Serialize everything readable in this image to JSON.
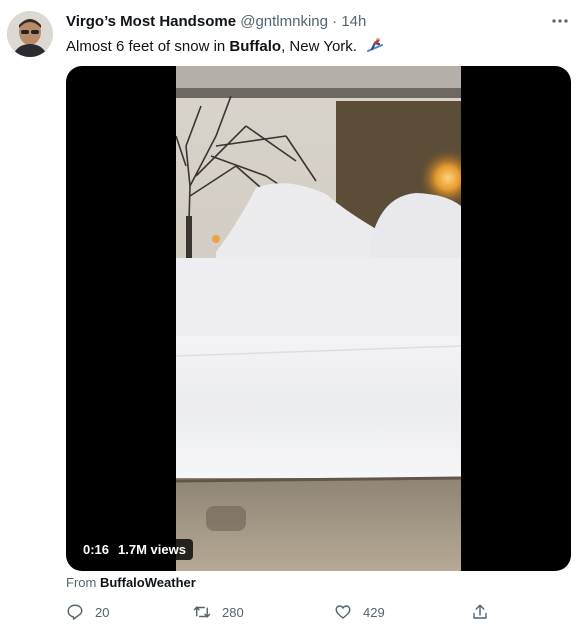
{
  "tweet": {
    "author_name": "Virgo’s Most Handsome",
    "handle": "@gntlmnking",
    "separator": "·",
    "time": "14h",
    "text_before": "Almost 6 feet of snow in ",
    "text_bold": "Buffalo",
    "text_after": ", New York."
  },
  "media": {
    "duration": "0:16",
    "views": "1.7M views"
  },
  "attribution": {
    "prefix": "From",
    "source": "BuffaloWeather"
  },
  "actions": {
    "replies": "20",
    "retweets": "280",
    "likes": "429"
  },
  "icons": {
    "more": "more-horizontal-icon",
    "reply": "reply-icon",
    "retweet": "retweet-icon",
    "like": "heart-icon",
    "share": "share-icon",
    "emoji": "skier-emoji-icon"
  },
  "colors": {
    "text_primary": "#0f1419",
    "text_secondary": "#536471",
    "media_background": "#000000"
  }
}
